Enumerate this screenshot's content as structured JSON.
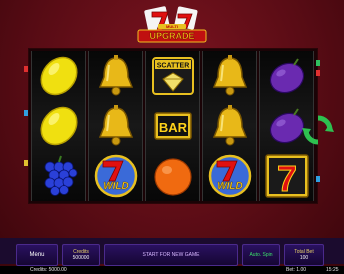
{
  "logo": {
    "text": "UPGRADE",
    "small_text": "MULTI"
  },
  "reels": [
    [
      "lemon",
      "lemon",
      "grapes"
    ],
    [
      "bell",
      "bell",
      "wild"
    ],
    [
      "scatter",
      "bar",
      "orange"
    ],
    [
      "bell",
      "bell",
      "wild"
    ],
    [
      "plum",
      "plum",
      "seven"
    ]
  ],
  "symbols": {
    "scatter_label": "SCATTER",
    "bar_label": "BAR",
    "wild_label": "WILD",
    "seven_label": "7"
  },
  "controls": {
    "menu_label": "Menu",
    "credits_label": "Credits",
    "credits_value": "500000",
    "start_label": "START FOR NEW GAME",
    "auto_label": "Auto. Spin",
    "totalbet_label": "Total Bet",
    "totalbet_value": "100"
  },
  "status": {
    "credits_text": "Credits: 5000.00",
    "bet_text": "Bet: 1.00",
    "time_text": "15:25"
  },
  "colors": {
    "background": "#5a0c15",
    "button": "#1f0a48",
    "gold": "#e8d36a",
    "auto_green": "#3be06a"
  }
}
